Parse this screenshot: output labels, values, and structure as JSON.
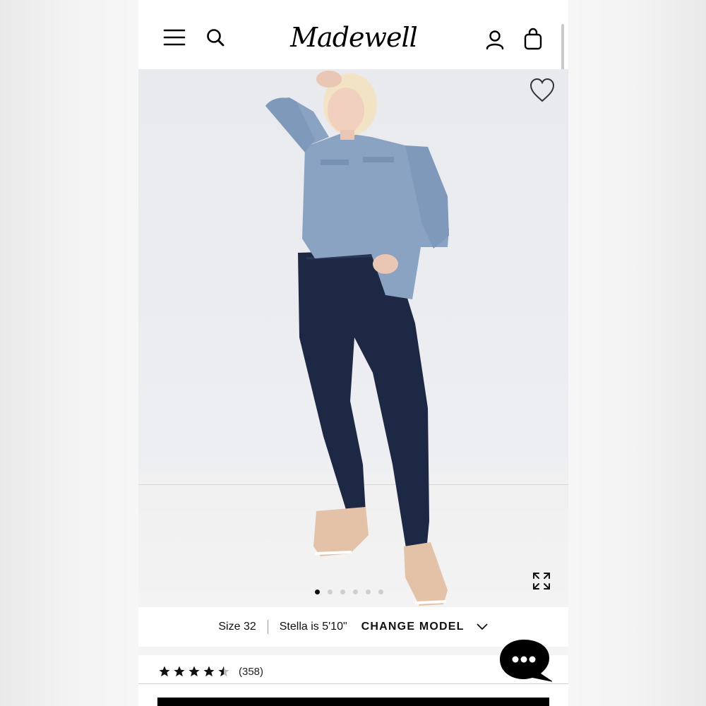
{
  "header": {
    "brand": "Madewell",
    "icons": [
      "menu-icon",
      "search-icon",
      "account-icon",
      "bag-icon"
    ]
  },
  "product_image": {
    "wishlist_icon": "heart-outline-icon",
    "expand_icon": "expand-icon",
    "slide_count": 6,
    "active_slide": 1
  },
  "model_info": {
    "size": "Size 32",
    "model_height": "Stella is 5'10\"",
    "change_label": "CHANGE MODEL",
    "dropdown_icon": "chevron-down-icon"
  },
  "reviews": {
    "rating": 4.5,
    "count": "(358)"
  },
  "chat": {
    "icon": "chat-bubble-icon"
  },
  "colors": {
    "brand_black": "#000000",
    "dot_inactive": "#cfcfd2",
    "shirt_denim": "#8aa3c2",
    "jeans_indigo": "#1e2a45",
    "sneaker_tan": "#e3c2a8"
  }
}
